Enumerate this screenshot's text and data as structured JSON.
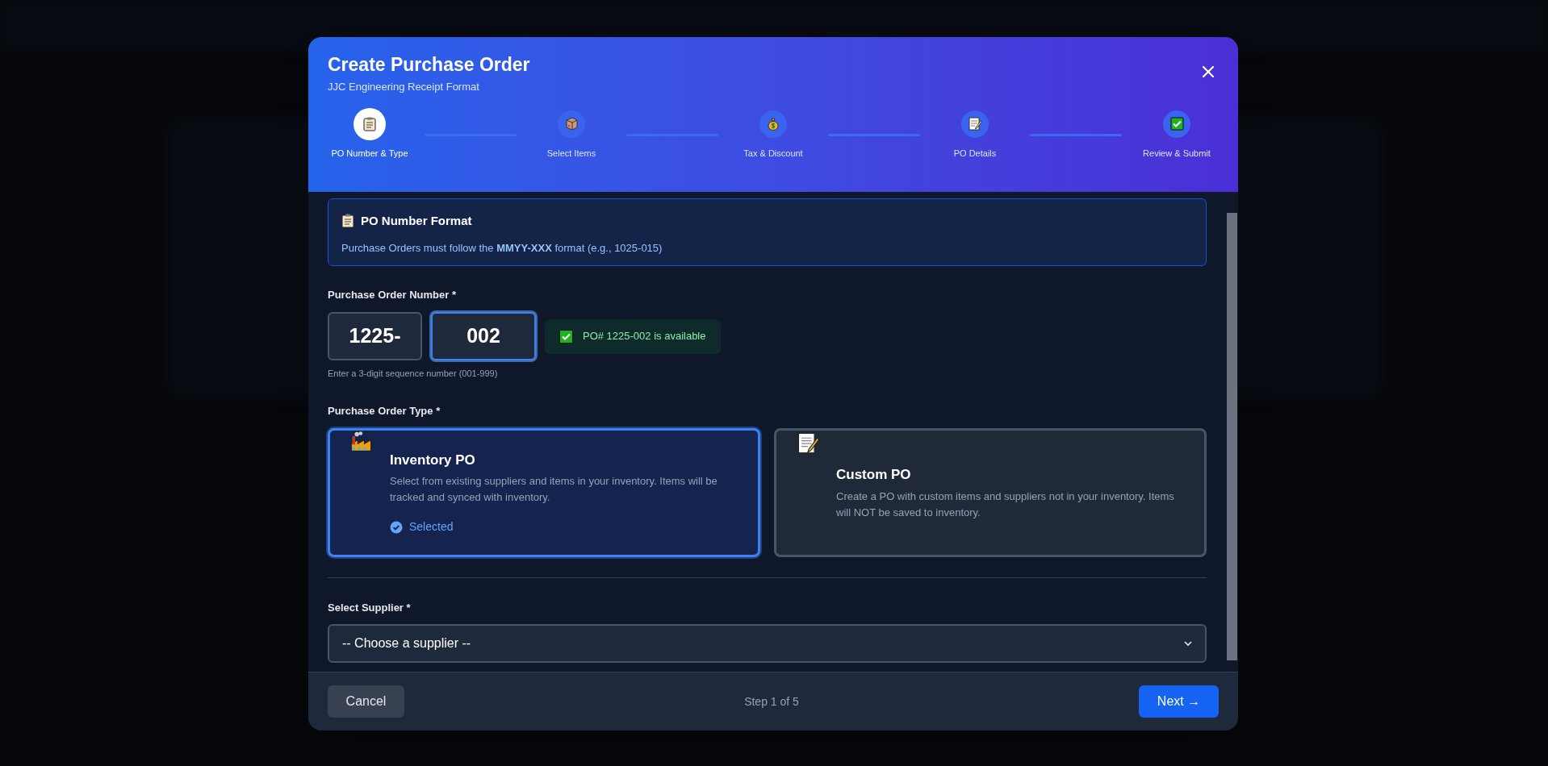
{
  "modal": {
    "title": "Create Purchase Order",
    "subtitle": "JJC Engineering Receipt Format"
  },
  "steps": [
    {
      "label": "PO Number & Type",
      "selected": true
    },
    {
      "label": "Select Items",
      "selected": false
    },
    {
      "label": "Tax & Discount",
      "selected": false
    },
    {
      "label": "PO Details",
      "selected": false
    },
    {
      "label": "Review & Submit",
      "selected": false
    }
  ],
  "info": {
    "title": "PO Number Format",
    "text": "Purchase Orders must follow the **MMYY-XXX** format (e.g., 1025-015)"
  },
  "po_number": {
    "label": "Purchase Order Number *",
    "prefix": "1225-",
    "value": "002",
    "available": true,
    "availability": "PO# 1225-002 is available",
    "hint": "Enter a 3-digit sequence number (001-999)"
  },
  "po_type": {
    "label": "Purchase Order Type *",
    "selected_text": "Selected",
    "options": [
      {
        "title": "Inventory PO",
        "description": "Select from existing suppliers and items in your inventory. Items will be tracked and synced with inventory.",
        "selected": true
      },
      {
        "title": "Custom PO",
        "description": "Create a PO with custom items and suppliers not in your inventory. Items will NOT be saved to inventory.",
        "selected": false
      }
    ]
  },
  "supplier": {
    "label": "Select Supplier *",
    "value": "-- Choose a supplier --"
  },
  "footer": {
    "cancel": "Cancel",
    "step": "Step 1 of 5",
    "next": "Next →"
  }
}
